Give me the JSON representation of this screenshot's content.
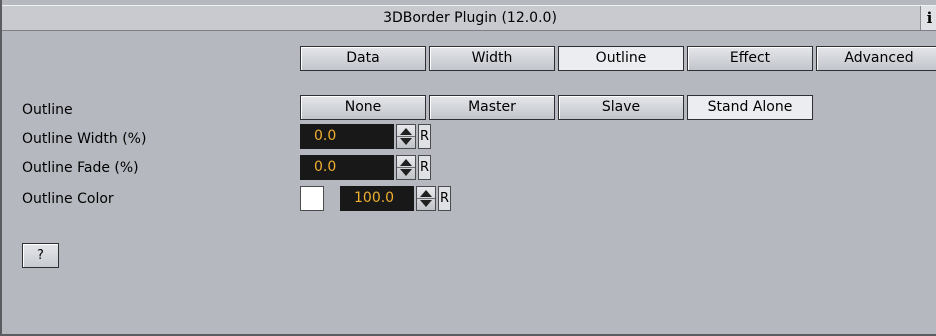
{
  "window": {
    "title": "3DBorder Plugin (12.0.0)",
    "info_label": "i"
  },
  "tabs": [
    {
      "label": "Data",
      "active": false
    },
    {
      "label": "Width",
      "active": false
    },
    {
      "label": "Outline",
      "active": true
    },
    {
      "label": "Effect",
      "active": false
    },
    {
      "label": "Advanced",
      "active": false
    }
  ],
  "outline": {
    "label": "Outline",
    "modes": [
      {
        "label": "None",
        "active": false
      },
      {
        "label": "Master",
        "active": false
      },
      {
        "label": "Slave",
        "active": false
      },
      {
        "label": "Stand Alone",
        "active": true
      }
    ]
  },
  "outline_width": {
    "label": "Outline Width (%)",
    "value": "0.0",
    "reset_label": "R"
  },
  "outline_fade": {
    "label": "Outline Fade (%)",
    "value": "0.0",
    "reset_label": "R"
  },
  "outline_color": {
    "label": "Outline Color",
    "color": "#ffffff",
    "value": "100.0",
    "reset_label": "R"
  },
  "help": {
    "label": "?"
  }
}
